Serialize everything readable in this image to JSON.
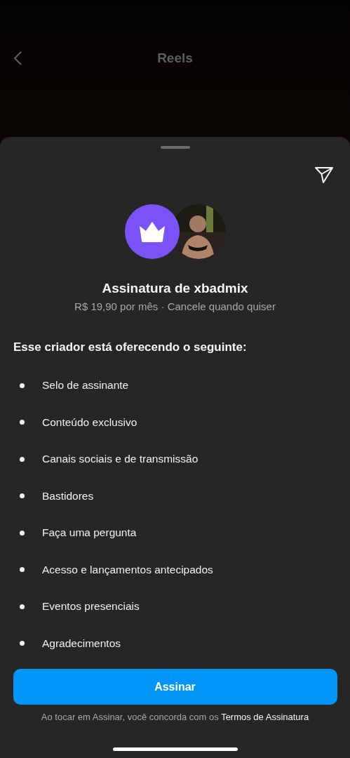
{
  "header": {
    "title": "Reels"
  },
  "sheet": {
    "title": "Assinatura de xbadmix",
    "subtitle": "R$ 19,90 por mês · Cancele quando quiser",
    "heading": "Esse criador está oferecendo o seguinte:",
    "benefits": [
      "Selo de assinante",
      "Conteúdo exclusivo",
      "Canais sociais e de transmissão",
      "Bastidores",
      "Faça uma pergunta",
      "Acesso e lançamentos antecipados",
      "Eventos presenciais",
      "Agradecimentos"
    ],
    "button": "Assinar",
    "terms": {
      "text": "Ao tocar em Assinar, você concorda com os",
      "link": "Termos de Assinatura"
    }
  }
}
